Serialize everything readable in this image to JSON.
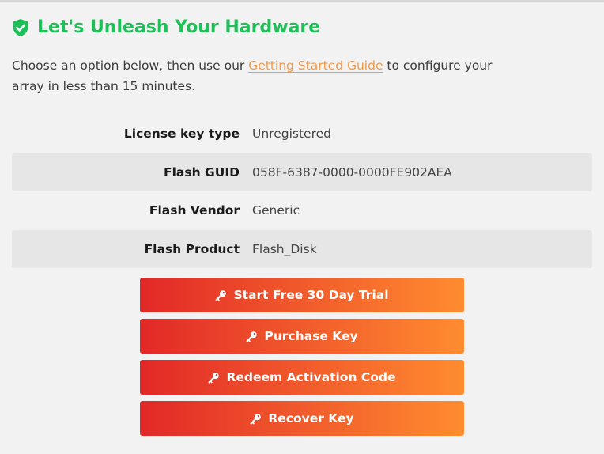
{
  "colors": {
    "accent_green": "#1ec05a",
    "link_orange": "#ef9a4c",
    "button_gradient_start": "#e22828",
    "button_gradient_end": "#ff8c2f"
  },
  "header": {
    "title": "Let's Unleash Your Hardware",
    "icon": "shield-check-icon"
  },
  "intro": {
    "text_before": "Choose an option below, then use our ",
    "link_label": "Getting Started Guide",
    "text_after": " to configure your array in less than 15 minutes."
  },
  "info": {
    "rows": [
      {
        "label": "License key type",
        "value": "Unregistered"
      },
      {
        "label": "Flash GUID",
        "value": "058F-6387-0000-0000FE902AEA"
      },
      {
        "label": "Flash Vendor",
        "value": "Generic"
      },
      {
        "label": "Flash Product",
        "value": "Flash_Disk"
      }
    ]
  },
  "actions": {
    "icon": "key-icon",
    "start_trial_label": "Start Free 30 Day Trial",
    "purchase_key_label": "Purchase Key",
    "redeem_code_label": "Redeem Activation Code",
    "recover_key_label": "Recover Key"
  }
}
